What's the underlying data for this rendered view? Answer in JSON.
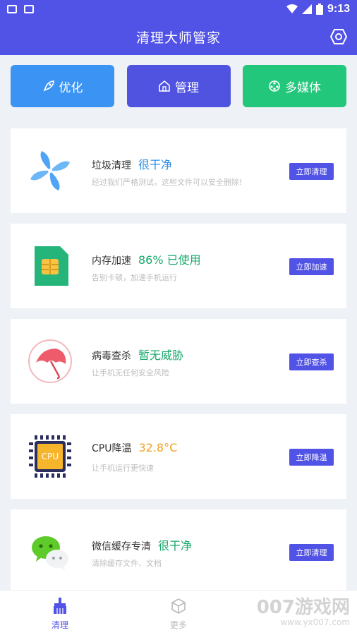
{
  "status_bar": {
    "time": "9:13",
    "icons": [
      "image-icon",
      "text-a-icon",
      "wifi-icon",
      "signal-icon",
      "battery-icon"
    ]
  },
  "header": {
    "title": "清理大师管家",
    "icon": "hexagon-settings-icon"
  },
  "quick_actions": [
    {
      "label": "优化",
      "icon": "rocket-icon",
      "color": "#3b94f3"
    },
    {
      "label": "管理",
      "icon": "home-icon",
      "color": "#5053e0"
    },
    {
      "label": "多媒体",
      "icon": "media-icon",
      "color": "#22c77c"
    }
  ],
  "cards": [
    {
      "title": "垃圾清理",
      "status": "很干净",
      "status_color": "#2f8fe6",
      "desc": "经过我们严格测试，这些文件可以安全删除!",
      "action": "立即清理",
      "icon": "pinwheel-icon"
    },
    {
      "title": "内存加速",
      "status": "86% 已使用",
      "status_color": "#18a96b",
      "desc": "告别卡顿，加速手机运行",
      "action": "立即加速",
      "icon": "sim-chip-icon"
    },
    {
      "title": "病毒查杀",
      "status": "暂无威胁",
      "status_color": "#18a96b",
      "desc": "让手机无任何安全风险",
      "action": "立即查杀",
      "icon": "umbrella-icon"
    },
    {
      "title": "CPU降温",
      "status": "32.8°C",
      "status_color": "#f0a21f",
      "desc": "让手机运行更快速",
      "action": "立即降温",
      "icon": "cpu-icon",
      "cpu_text": "CPU"
    },
    {
      "title": "微信缓存专清",
      "status": "很干净",
      "status_color": "#18a96b",
      "desc": "清除缓存文件、文档",
      "action": "立即清理",
      "icon": "wechat-icon"
    }
  ],
  "tabs": [
    {
      "label": "清理",
      "icon": "broom-icon",
      "active": true
    },
    {
      "label": "更多",
      "icon": "cube-icon",
      "active": false
    }
  ],
  "watermark": {
    "line1": "007游戏网",
    "line2": "www.yx007.com"
  }
}
